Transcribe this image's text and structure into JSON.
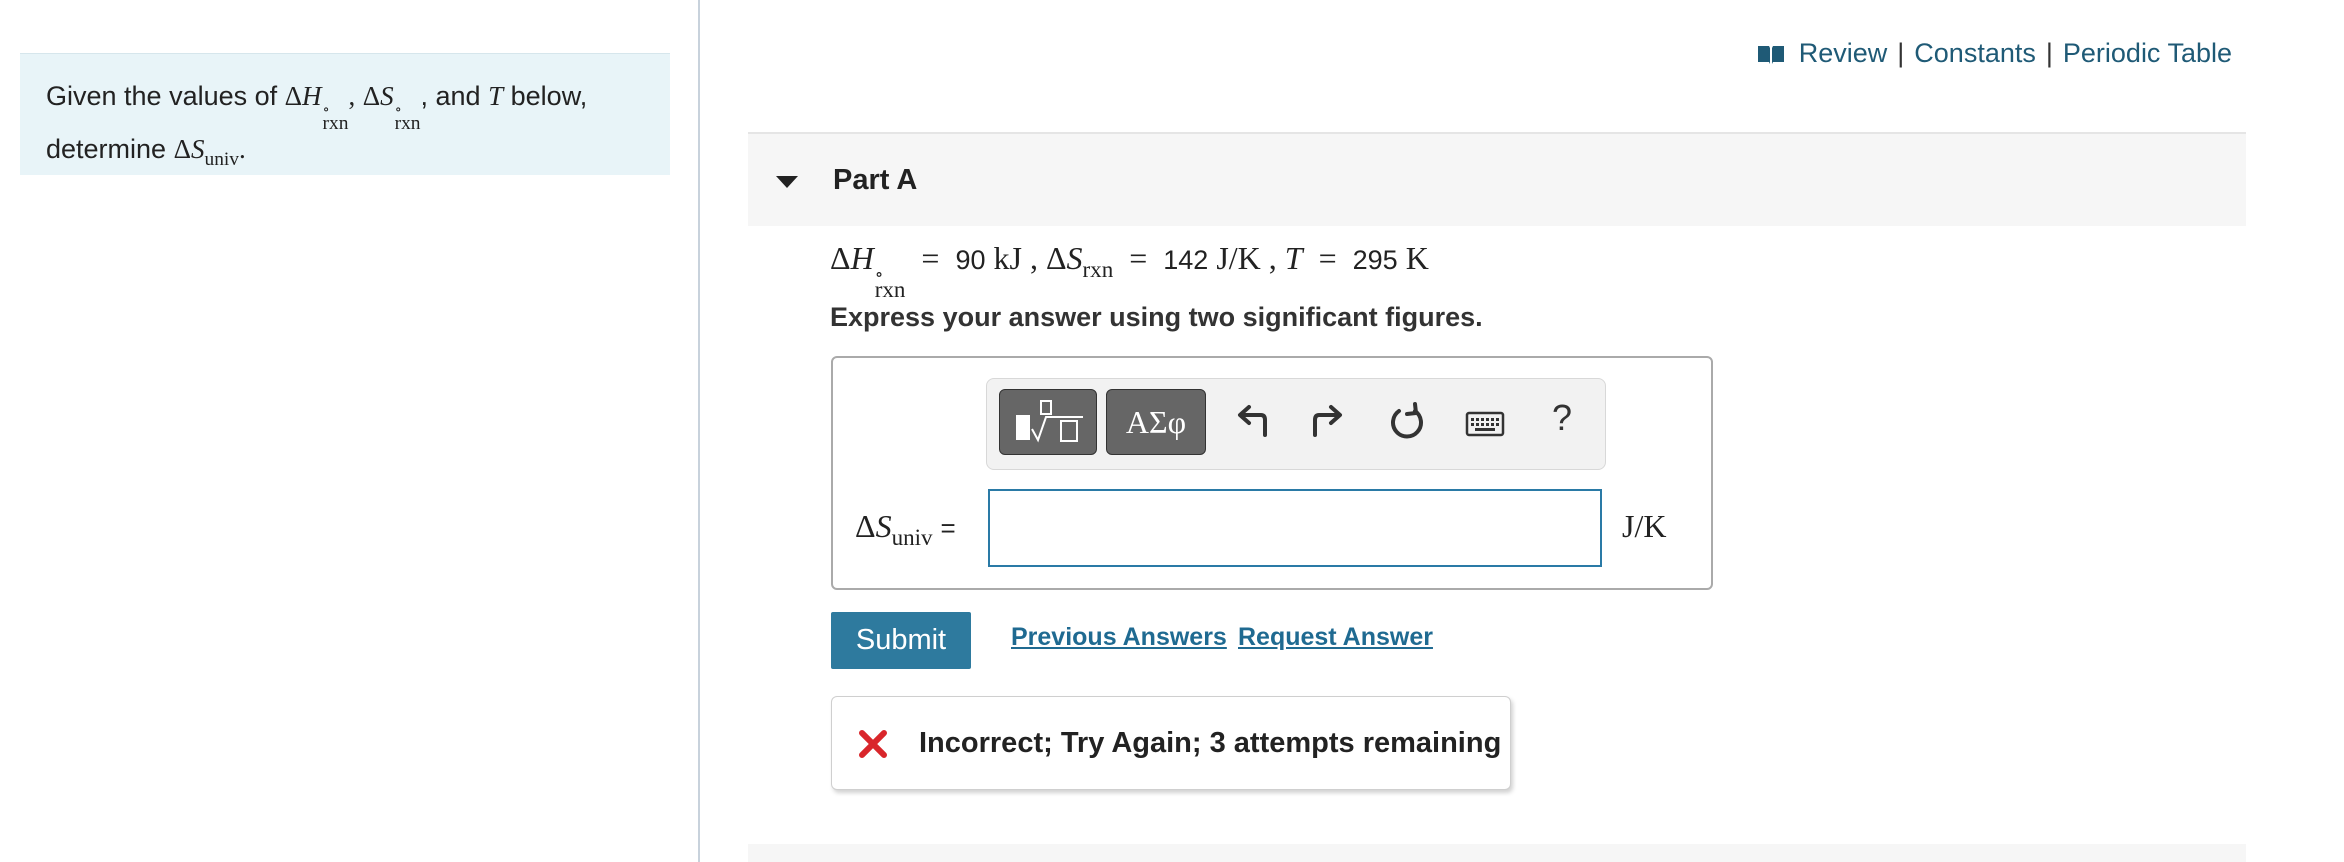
{
  "intro": {
    "text_prefix": "Given the values of",
    "delta": "Δ",
    "H": "H",
    "S": "S",
    "T": "T",
    "rxn": "rxn",
    "degree": "∘",
    "comma": ",",
    "and_text": ", and",
    "below_text": "below,",
    "determine_text": "determine",
    "univ": "univ",
    "period": "."
  },
  "top_links": {
    "review": "Review",
    "constants": "Constants",
    "periodic_table": "Periodic Table",
    "separator": "|"
  },
  "part": {
    "title": "Part A"
  },
  "given": {
    "dH_value": "90",
    "dH_unit": "kJ",
    "dS_value": "142",
    "dS_unit": "J/K",
    "T_value": "295",
    "T_unit": "K",
    "equals": "=",
    "comma": ","
  },
  "instruction": "Express your answer using two significant figures.",
  "toolbar": {
    "symbols_label": "ΑΣφ",
    "help_label": "?"
  },
  "answer": {
    "label_delta": "Δ",
    "label_S": "S",
    "label_sub": "univ",
    "label_equals": "=",
    "value": "",
    "unit": "J/K"
  },
  "actions": {
    "submit": "Submit",
    "previous_answers": "Previous Answers",
    "request_answer": "Request Answer"
  },
  "feedback": {
    "message": "Incorrect; Try Again; 3 attempts remaining"
  },
  "colors": {
    "intro_bg": "#e8f4f8",
    "link": "#1f5a76",
    "submit_bg": "#2e7a9e",
    "input_border": "#2a7aa6",
    "error": "#d9262b"
  },
  "icons": [
    "book-icon",
    "template-icon",
    "undo-icon",
    "redo-icon",
    "reset-icon",
    "keyboard-icon",
    "help-icon",
    "error-x-icon",
    "caret-down-icon"
  ]
}
